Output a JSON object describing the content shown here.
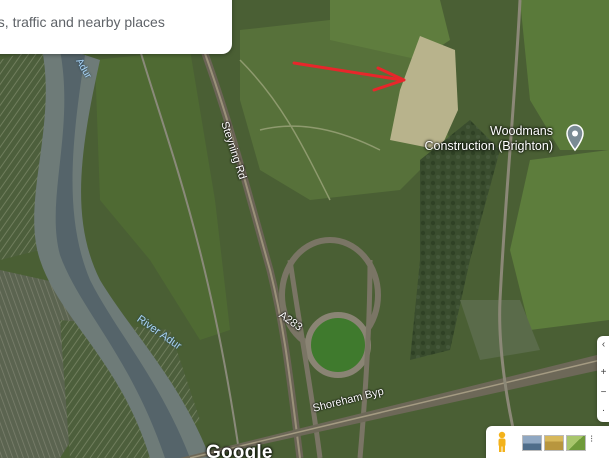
{
  "search": {
    "hint_text": "es, traffic and nearby places"
  },
  "map": {
    "roads": {
      "steyning_rd": "Steyning Rd",
      "a283": "A283",
      "shoreham_byp": "Shoreham Byp"
    },
    "water": {
      "river_adur": "River Adur",
      "adur_fragment": "Adur"
    },
    "poi": {
      "name": "Woodmans\nConstruction (Brighton)",
      "pin_icon": "place-pin-icon"
    },
    "annotation": {
      "arrow_color": "#e8262b",
      "icon": "red-arrow-icon"
    }
  },
  "branding": {
    "logo_text": "Google"
  },
  "controls": {
    "pegman_icon": "pegman-icon",
    "layers": [
      "satellite-layer-thumb",
      "terrain-layer-thumb",
      "street-view-layer-thumb"
    ],
    "side_buttons": [
      "chevron-icon",
      "plus-icon",
      "minus-icon",
      "dot-icon"
    ]
  }
}
